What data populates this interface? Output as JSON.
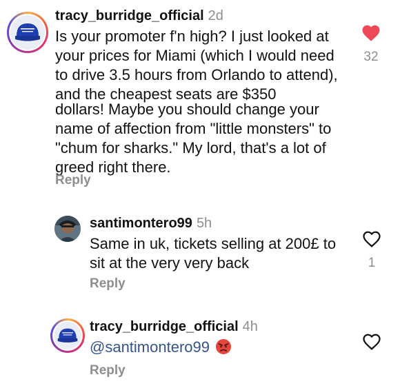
{
  "comments": [
    {
      "username": "tracy_burridge_official",
      "time": "2d",
      "text_p1": "Is your promoter f'n high? I just looked at your prices for Miami (which I would need to drive 3.5 hours from Orlando to attend), and the cheapest seats are $350",
      "text_p2": "dollars! Maybe you should change your name of affection from \"little monsters\" to \"chum for sharks.\" My lord, that's a lot of greed right there.",
      "reply_label": "Reply",
      "like_count": "32",
      "liked": true,
      "avatar_text": "SAVE AMERICA FROM EVIL"
    },
    {
      "username": "santimontero99",
      "time": "5h",
      "text": "Same in uk, tickets selling at 200£ to sit at the very very back",
      "reply_label": "Reply",
      "like_count": "1",
      "liked": false
    },
    {
      "username": "tracy_burridge_official",
      "time": "4h",
      "mention": "@santimontero99",
      "emoji": "angry-face",
      "reply_label": "Reply",
      "liked": false,
      "avatar_text": "SAVE AMERICA FROM EVIL"
    }
  ],
  "colors": {
    "like_red": "#ed4956",
    "muted": "#8e8e8e",
    "mention": "#35538a",
    "cap_blue": "#1f3fb0"
  }
}
